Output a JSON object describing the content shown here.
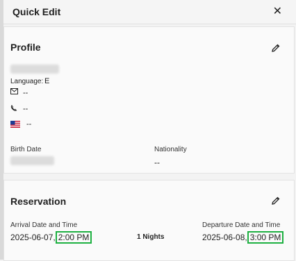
{
  "header": {
    "title": "Quick Edit",
    "close_icon": "close-icon"
  },
  "profile": {
    "title": "Profile",
    "language_label": "Language:",
    "language_value": "E",
    "email_value": "--",
    "phone_value": "--",
    "country_value": "--",
    "birth_date_label": "Birth Date",
    "nationality_label": "Nationality",
    "nationality_value": "--"
  },
  "reservation": {
    "title": "Reservation",
    "arrival_label": "Arrival Date and Time",
    "arrival_date": "2025-06-07,",
    "arrival_time": "2:00 PM",
    "nights": "1 Nights",
    "departure_label": "Departure Date and Time",
    "departure_date": "2025-06-08,",
    "departure_time": "3:00 PM"
  },
  "colors": {
    "highlight": "#1db041"
  }
}
